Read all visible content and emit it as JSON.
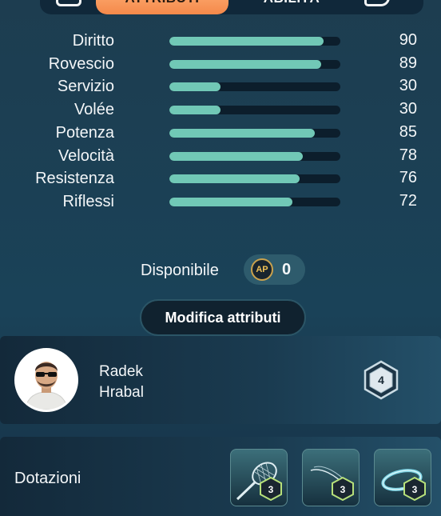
{
  "tabs": [
    {
      "label": "ATTRIBUTI",
      "active": true
    },
    {
      "label": "ABILITÀ",
      "active": false
    }
  ],
  "attributes": [
    {
      "label": "Diritto",
      "value": "90",
      "level": 90
    },
    {
      "label": "Rovescio",
      "value": "89",
      "level": 89
    },
    {
      "label": "Servizio",
      "value": "30",
      "level": 30
    },
    {
      "label": "Volée",
      "value": "30",
      "level": 30
    },
    {
      "label": "Potenza",
      "value": "85",
      "level": 85
    },
    {
      "label": "Velocità",
      "value": "78",
      "level": 78
    },
    {
      "label": "Resistenza",
      "value": "76",
      "level": 76
    },
    {
      "label": "Riflessi",
      "value": "72",
      "level": 72
    }
  ],
  "available": {
    "label": "Disponibile",
    "icon_text": "AP",
    "value": "0"
  },
  "modify_button": {
    "label": "Modifica attributi"
  },
  "coach": {
    "first_name": "Radek",
    "last_name": "Hrabal",
    "level": "4"
  },
  "equipment": {
    "label": "Dotazioni",
    "slots": [
      {
        "icon": "racket-icon",
        "level": "3"
      },
      {
        "icon": "string-icon",
        "level": "3"
      },
      {
        "icon": "grip-icon",
        "level": "3"
      }
    ]
  },
  "colors": {
    "bar_fill": "#71c8b6",
    "bar_track": "#0c1e2c",
    "tab_active": "#f5894a",
    "ap_gold": "#caa24d"
  }
}
